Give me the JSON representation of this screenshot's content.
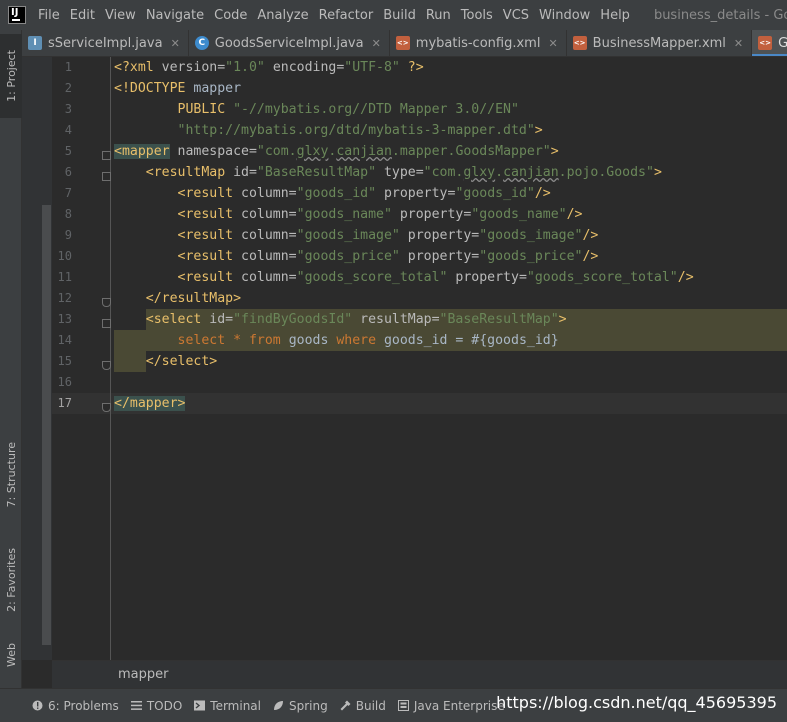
{
  "menubar": {
    "items": [
      "File",
      "Edit",
      "View",
      "Navigate",
      "Code",
      "Analyze",
      "Refactor",
      "Build",
      "Run",
      "Tools",
      "VCS",
      "Window",
      "Help"
    ],
    "window_title": "business_details - GoodsM"
  },
  "tabs": [
    {
      "label": "sServiceImpl.java",
      "icon": "java-interface-icon",
      "active": false
    },
    {
      "label": "GoodsServiceImpl.java",
      "icon": "java-class-icon",
      "active": false
    },
    {
      "label": "mybatis-config.xml",
      "icon": "xml-file-icon",
      "active": false
    },
    {
      "label": "BusinessMapper.xml",
      "icon": "xml-file-icon",
      "active": false
    },
    {
      "label": "GoodsMappe",
      "icon": "xml-file-icon",
      "active": true
    }
  ],
  "left_tools": {
    "project": "1: Project",
    "structure": "7: Structure",
    "favorites": "2: Favorites",
    "web": "Web"
  },
  "editor": {
    "line_numbers": [
      "1",
      "2",
      "3",
      "4",
      "5",
      "6",
      "7",
      "8",
      "9",
      "10",
      "11",
      "12",
      "13",
      "14",
      "15",
      "16",
      "17"
    ],
    "current_line": 17
  },
  "breadcrumb": "mapper",
  "bottom_tools": [
    {
      "label": "6: Problems",
      "icon": "problems-icon"
    },
    {
      "label": "TODO",
      "icon": "todo-icon"
    },
    {
      "label": "Terminal",
      "icon": "terminal-icon"
    },
    {
      "label": "Spring",
      "icon": "spring-icon"
    },
    {
      "label": "Build",
      "icon": "build-icon"
    },
    {
      "label": "Java Enterprise",
      "icon": "java-enterprise-icon"
    }
  ],
  "watermark": "https://blog.csdn.net/qq_45695395",
  "colors": {
    "background": "#2b2b2b",
    "tag": "#e8bf6a",
    "string": "#6a8759",
    "keyword": "#cc7832",
    "active_tab_underline": "#4a88c7"
  }
}
